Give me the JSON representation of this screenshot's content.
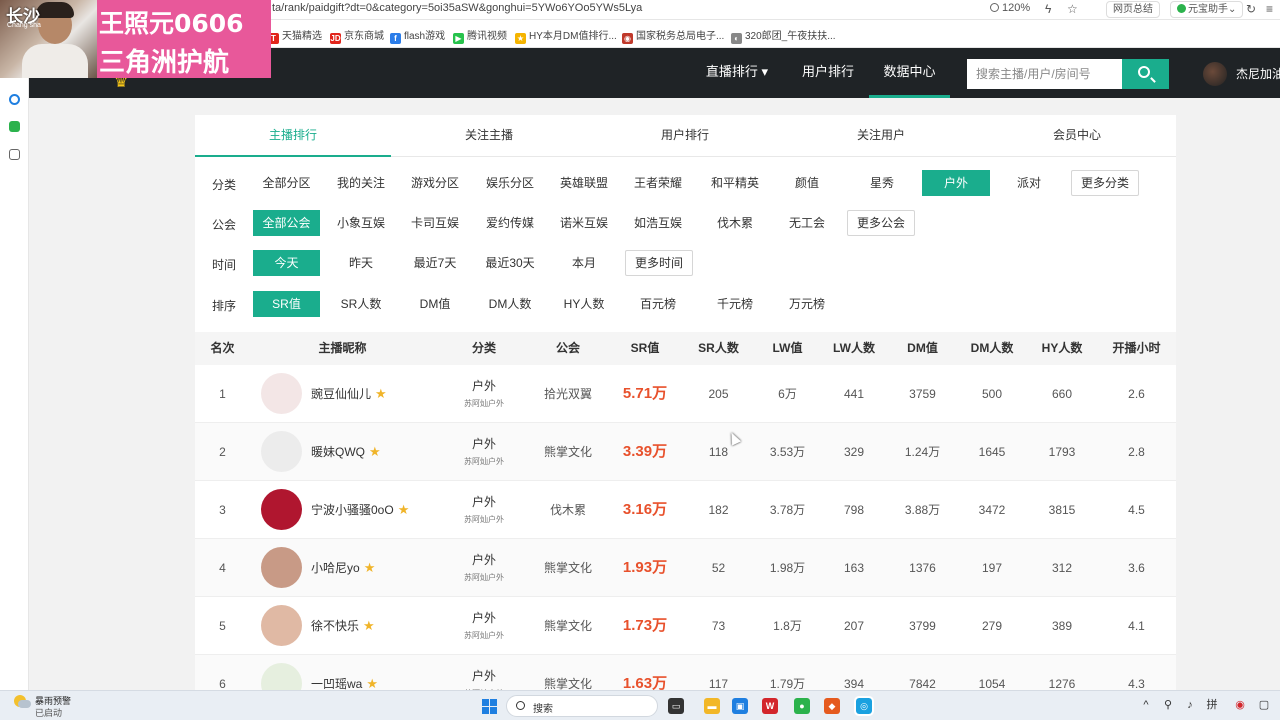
{
  "browser": {
    "url": "ta/rank/paidgift?dt=0&category=5oi35aSW&gonghui=5YWo6YOo5YWs5Lya",
    "zoom": "120%",
    "web_summary": "网页总结",
    "yuanbao": "元宝助手"
  },
  "bookmarks": [
    {
      "label": "天猫精选",
      "icon": "T",
      "color": "#e1251b"
    },
    {
      "label": "京东商城",
      "icon": "JD",
      "color": "#e1251b"
    },
    {
      "label": "flash游戏",
      "icon": "f",
      "color": "#2b7de9"
    },
    {
      "label": "腾讯视频",
      "icon": "▶",
      "color": "#27c24c"
    },
    {
      "label": "HY本月DM值排行...",
      "icon": "★",
      "color": "#f5b400"
    },
    {
      "label": "国家税务总局电子...",
      "icon": "◉",
      "color": "#c0392b"
    },
    {
      "label": "320郎团_午夜扶扶...",
      "icon": "◐",
      "color": "#888888"
    }
  ],
  "overlay": {
    "city": "长沙",
    "city_sub": "Chang sha",
    "line1": "王照元0606",
    "line2": "三角洲护航"
  },
  "nav": {
    "items": [
      "直播排行 ▾",
      "用户排行",
      "数据中心"
    ],
    "active": 2,
    "search_placeholder": "搜索主播/用户/房间号",
    "username": "杰尼加油"
  },
  "tabs": [
    "主播排行",
    "关注主播",
    "用户排行",
    "关注用户",
    "会员中心"
  ],
  "active_tab": 0,
  "filters": [
    {
      "label": "分类",
      "options": [
        "全部分区",
        "我的关注",
        "游戏分区",
        "娱乐分区",
        "英雄联盟",
        "王者荣耀",
        "和平精英",
        "颜值",
        "星秀",
        "户外",
        "派对"
      ],
      "active": 9,
      "more": "更多分类"
    },
    {
      "label": "公会",
      "options": [
        "全部公会",
        "小象互娱",
        "卡司互娱",
        "爱约传媒",
        "诺米互娱",
        "如浩互娱",
        "伐木累",
        "无工会"
      ],
      "active": 0,
      "more": "更多公会"
    },
    {
      "label": "时间",
      "options": [
        "今天",
        "昨天",
        "最近7天",
        "最近30天",
        "本月"
      ],
      "active": 0,
      "more": "更多时间"
    },
    {
      "label": "排序",
      "options": [
        "SR值",
        "SR人数",
        "DM值",
        "DM人数",
        "HY人数",
        "百元榜",
        "千元榜",
        "万元榜"
      ],
      "active": 0,
      "more": ""
    }
  ],
  "table": {
    "headers": [
      "名次",
      "主播昵称",
      "分类",
      "公会",
      "SR值",
      "SR人数",
      "LW值",
      "LW人数",
      "DM值",
      "DM人数",
      "HY人数",
      "开播小时"
    ],
    "rows": [
      {
        "rank": "1",
        "name": "豌豆仙仙儿",
        "cat": "户外",
        "subcat": "苏阿灿户外",
        "guild": "拾光双翼",
        "sr": "5.71万",
        "sr_n": "205",
        "lw": "6万",
        "lw_n": "441",
        "dm": "3759",
        "dm_n": "500",
        "hy_n": "660",
        "hours": "2.6",
        "avatar": "#f3e6e6"
      },
      {
        "rank": "2",
        "name": "暖妹QWQ",
        "cat": "户外",
        "subcat": "苏阿灿户外",
        "guild": "熊掌文化",
        "sr": "3.39万",
        "sr_n": "118",
        "lw": "3.53万",
        "lw_n": "329",
        "dm": "1.24万",
        "dm_n": "1645",
        "hy_n": "1793",
        "hours": "2.8",
        "avatar": "#ececec"
      },
      {
        "rank": "3",
        "name": "宁波小骚骚0oO",
        "cat": "户外",
        "subcat": "苏阿灿户外",
        "guild": "伐木累",
        "sr": "3.16万",
        "sr_n": "182",
        "lw": "3.78万",
        "lw_n": "798",
        "dm": "3.88万",
        "dm_n": "3472",
        "hy_n": "3815",
        "hours": "4.5",
        "avatar": "#b0162f"
      },
      {
        "rank": "4",
        "name": "小哈尼yo",
        "cat": "户外",
        "subcat": "苏阿灿户外",
        "guild": "熊掌文化",
        "sr": "1.93万",
        "sr_n": "52",
        "lw": "1.98万",
        "lw_n": "163",
        "dm": "1376",
        "dm_n": "197",
        "hy_n": "312",
        "hours": "3.6",
        "avatar": "#c89a86"
      },
      {
        "rank": "5",
        "name": "徐不快乐",
        "cat": "户外",
        "subcat": "苏阿灿户外",
        "guild": "熊掌文化",
        "sr": "1.73万",
        "sr_n": "73",
        "lw": "1.8万",
        "lw_n": "207",
        "dm": "3799",
        "dm_n": "279",
        "hy_n": "389",
        "hours": "4.1",
        "avatar": "#e0b9a4"
      },
      {
        "rank": "6",
        "name": "一凹瑶wa",
        "cat": "户外",
        "subcat": "苏阿灿户外",
        "guild": "熊掌文化",
        "sr": "1.63万",
        "sr_n": "117",
        "lw": "1.79万",
        "lw_n": "394",
        "dm": "7842",
        "dm_n": "1054",
        "hy_n": "1276",
        "hours": "4.3",
        "avatar": "#e6efdf"
      }
    ]
  },
  "taskbar": {
    "weather_title": "暴雨预警",
    "weather_sub": "已启动",
    "search": "搜索"
  }
}
